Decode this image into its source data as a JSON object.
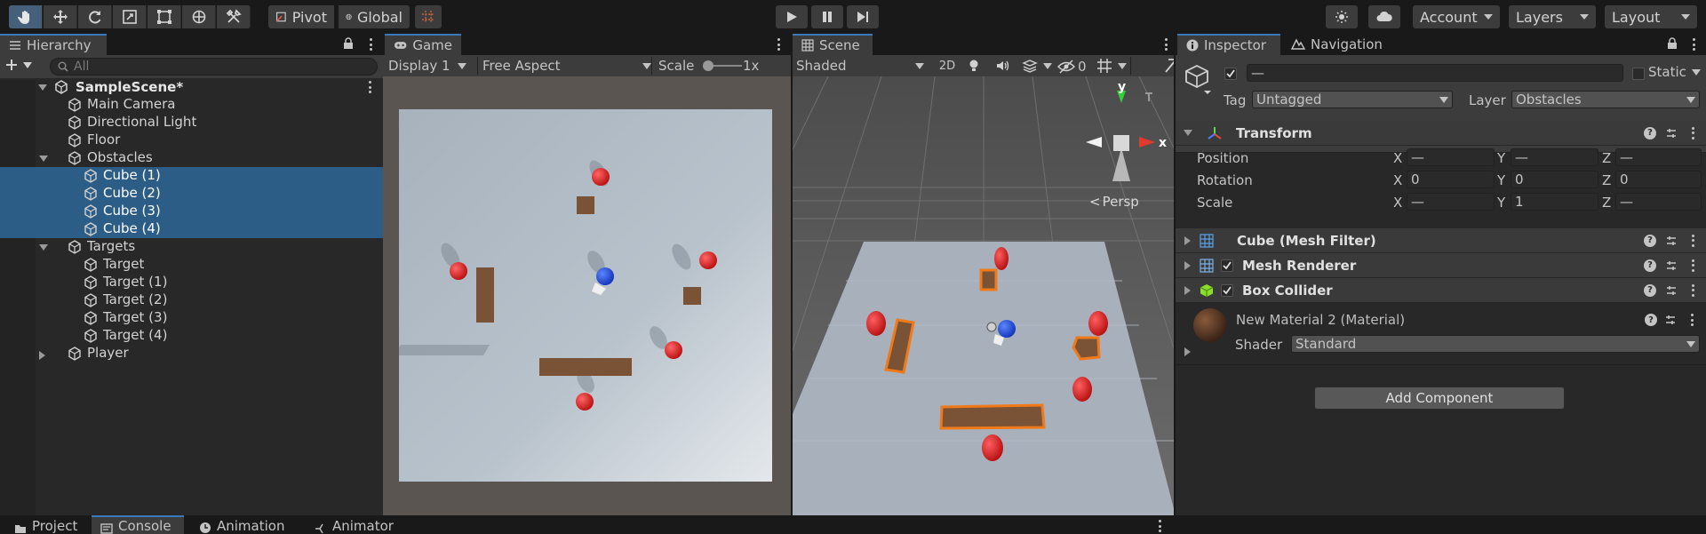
{
  "toolbar": {
    "pivot": "Pivot",
    "global": "Global",
    "account": "Account",
    "layers": "Layers",
    "layout": "Layout"
  },
  "hierarchy": {
    "tab": "Hierarchy",
    "search_placeholder": "All",
    "scene": "SampleScene*",
    "items": [
      {
        "label": "Main Camera"
      },
      {
        "label": "Directional Light"
      },
      {
        "label": "Floor"
      },
      {
        "label": "Obstacles"
      },
      {
        "label": "Cube (1)"
      },
      {
        "label": "Cube (2)"
      },
      {
        "label": "Cube (3)"
      },
      {
        "label": "Cube (4)"
      },
      {
        "label": "Targets"
      },
      {
        "label": "Target"
      },
      {
        "label": "Target (1)"
      },
      {
        "label": "Target (2)"
      },
      {
        "label": "Target (3)"
      },
      {
        "label": "Target (4)"
      },
      {
        "label": "Player"
      }
    ]
  },
  "game": {
    "tab": "Game",
    "display": "Display 1",
    "aspect": "Free Aspect",
    "scale_label": "Scale",
    "scale_value": "1x"
  },
  "scene": {
    "tab": "Scene",
    "shading": "Shaded",
    "mode_2d": "2D",
    "hidden_count": "0",
    "gizmo_y": "y",
    "gizmo_x": "x",
    "persp": "Persp"
  },
  "inspector": {
    "tab": "Inspector",
    "nav_tab": "Navigation",
    "name_value": "—",
    "static_label": "Static",
    "tag_label": "Tag",
    "tag_value": "Untagged",
    "layer_label": "Layer",
    "layer_value": "Obstacles",
    "transform": {
      "title": "Transform",
      "rows": [
        {
          "label": "Position",
          "x": "—",
          "y": "—",
          "z": "—"
        },
        {
          "label": "Rotation",
          "x": "0",
          "y": "0",
          "z": "0"
        },
        {
          "label": "Scale",
          "x": "—",
          "y": "1",
          "z": "—"
        }
      ],
      "axis_x": "X",
      "axis_y": "Y",
      "axis_z": "Z"
    },
    "mesh_filter": "Cube (Mesh Filter)",
    "mesh_renderer": "Mesh Renderer",
    "box_collider": "Box Collider",
    "material": "New Material 2 (Material)",
    "shader_label": "Shader",
    "shader_value": "Standard",
    "add_component": "Add Component"
  },
  "bottom_tabs": [
    {
      "label": "Project"
    },
    {
      "label": "Console"
    },
    {
      "label": "Animation"
    },
    {
      "label": "Animator"
    }
  ],
  "colors": {
    "selection": "#2c5d87",
    "accent": "#3a79bb",
    "obstacle": "#7a5236",
    "target": "#d11d1d",
    "player": "#1f48d6",
    "outline": "#f07a1a"
  }
}
